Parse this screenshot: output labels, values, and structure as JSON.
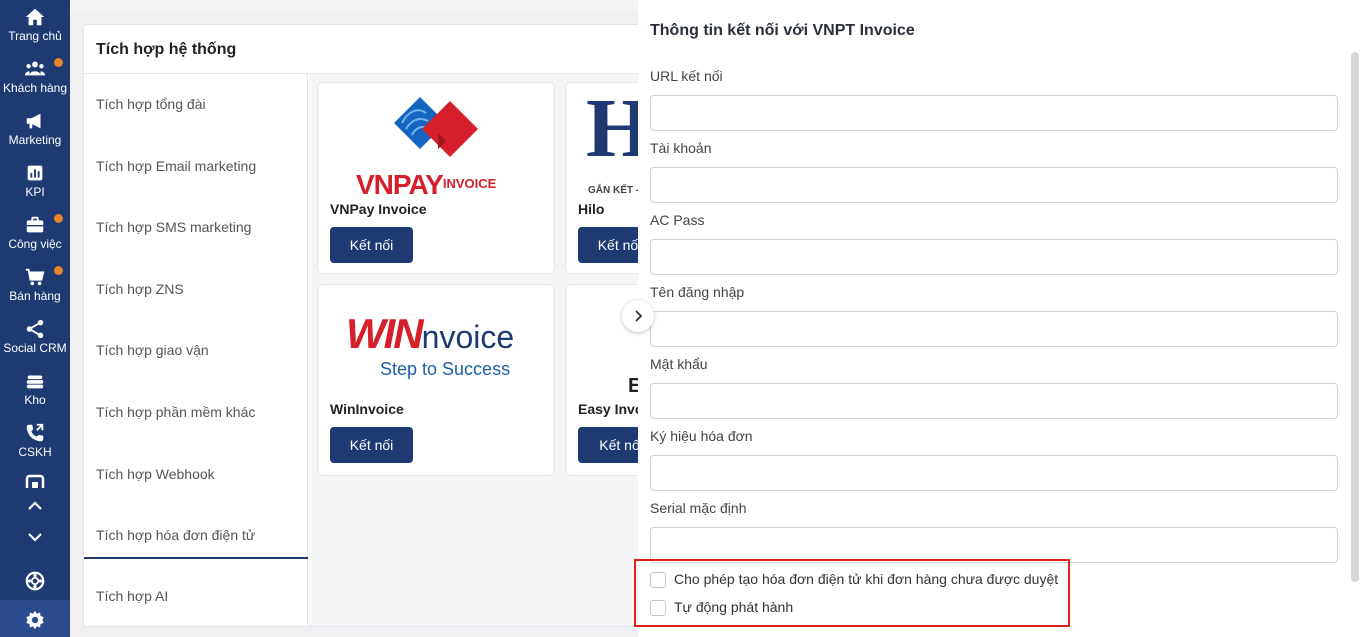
{
  "nav": {
    "items": [
      {
        "label": "Trang chủ",
        "icon": "home-icon",
        "badge": false
      },
      {
        "label": "Khách hàng",
        "icon": "users-icon",
        "badge": true
      },
      {
        "label": "Marketing",
        "icon": "megaphone-icon",
        "badge": false
      },
      {
        "label": "KPI",
        "icon": "chart-icon",
        "badge": false
      },
      {
        "label": "Công việc",
        "icon": "briefcase-icon",
        "badge": true
      },
      {
        "label": "Bán hàng",
        "icon": "cart-icon",
        "badge": true
      },
      {
        "label": "Social CRM",
        "icon": "share-icon",
        "badge": false
      },
      {
        "label": "Kho",
        "icon": "warehouse-icon",
        "badge": false
      },
      {
        "label": "CSKH",
        "icon": "phone-icon",
        "badge": false
      }
    ]
  },
  "panel": {
    "title": "Tích hợp hệ thống",
    "menu": [
      "Tích hợp tổng đài",
      "Tích hợp Email marketing",
      "Tích hợp SMS marketing",
      "Tích hợp ZNS",
      "Tích hợp giao vận",
      "Tích hợp phần mềm khác",
      "Tích hợp Webhook",
      "Tích hợp hóa đơn điện tử",
      "Tích hợp AI"
    ],
    "cards": [
      {
        "name": "VNPay Invoice",
        "button": "Kết nối",
        "logo_main": "VNPAY",
        "logo_sub": "INVOICE"
      },
      {
        "name": "Hilo",
        "button": "Kết nối",
        "logo_main": "H",
        "logo_sub": "GẮN KẾT -"
      },
      {
        "name": "WinInvoice",
        "button": "Kết nối",
        "logo_main": "WIN",
        "logo_mid": "nvoice",
        "logo_sub": "Step to Success"
      },
      {
        "name": "Easy Invo",
        "button": "Kết nố",
        "logo_main": "E"
      }
    ]
  },
  "drawer": {
    "title": "Thông tin kết nối với VNPT Invoice",
    "fields": [
      {
        "label": "URL kết nối",
        "value": ""
      },
      {
        "label": "Tài khoản",
        "value": ""
      },
      {
        "label": "AC Pass",
        "value": ""
      },
      {
        "label": "Tên đăng nhập",
        "value": ""
      },
      {
        "label": "Mật khẩu",
        "value": ""
      },
      {
        "label": "Ký hiệu hóa đơn",
        "value": ""
      },
      {
        "label": "Serial mặc định",
        "value": ""
      }
    ],
    "checkboxes": [
      {
        "label": "Cho phép tạo hóa đơn điện tử khi đơn hàng chưa được duyệt",
        "checked": false
      },
      {
        "label": "Tự động phát hành",
        "checked": false
      }
    ]
  },
  "colors": {
    "nav_bg": "#1f3a73",
    "primary_button": "#1f3a73",
    "badge": "#e8822c",
    "highlight_border": "#e0201b",
    "vnpay_red": "#d51f2a",
    "vnpay_blue": "#1565c0"
  }
}
